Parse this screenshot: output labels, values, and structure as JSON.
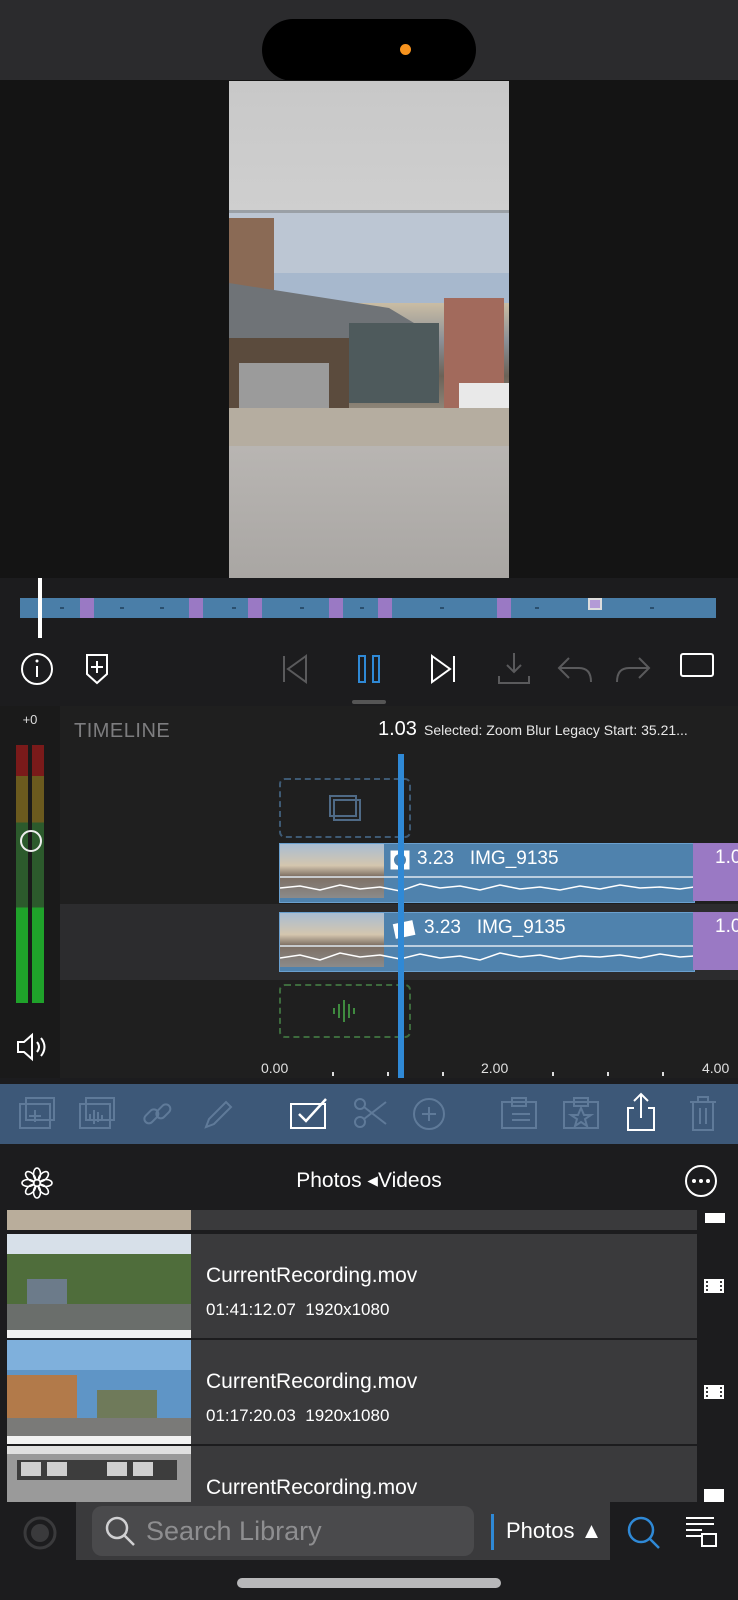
{
  "colors": {
    "accent_blue": "#2f89d6",
    "clip_blue": "#4f82ad",
    "marker_purple": "#9a79c4",
    "toolbar_bg": "#3d5878",
    "recording_dot": "#f7931e"
  },
  "timeline": {
    "label": "TIMELINE",
    "current_time": "1.03",
    "selected_info": "Selected: Zoom Blur Legacy Start: 35.21...",
    "gain": "+0",
    "video_clip": {
      "duration": "3.23",
      "name": "IMG_9135"
    },
    "audio_clip": {
      "duration": "3.23",
      "name": "IMG_9135"
    },
    "next_clip_label": "1.0",
    "next_clip_label_2": "1.0",
    "ruler": [
      "0.00",
      "2.00",
      "4.00"
    ]
  },
  "library": {
    "title": "Photos ◂Videos",
    "items": [
      {
        "name": "CurrentRecording.mov",
        "duration": "01:41:12.07",
        "resolution": "1920x1080"
      },
      {
        "name": "CurrentRecording.mov",
        "duration": "01:17:20.03",
        "resolution": "1920x1080"
      },
      {
        "name": "CurrentRecording.mov"
      }
    ]
  },
  "bottom_bar": {
    "search_placeholder": "Search Library",
    "source_label": "Photos ▲"
  },
  "icons": [
    "info-icon",
    "add-marker-icon",
    "skip-start-icon",
    "pause-icon",
    "skip-end-icon",
    "download-icon",
    "undo-icon",
    "redo-icon",
    "aspect-icon",
    "speaker-icon",
    "add-clip-icon",
    "add-audio-icon",
    "link-icon",
    "pencil-icon",
    "select-icon",
    "scissors-icon",
    "add-icon",
    "clipboard-icon",
    "favorite-icon",
    "share-icon",
    "trash-icon",
    "flower-icon",
    "more-icon",
    "film-icon",
    "search-icon",
    "list-icon"
  ]
}
